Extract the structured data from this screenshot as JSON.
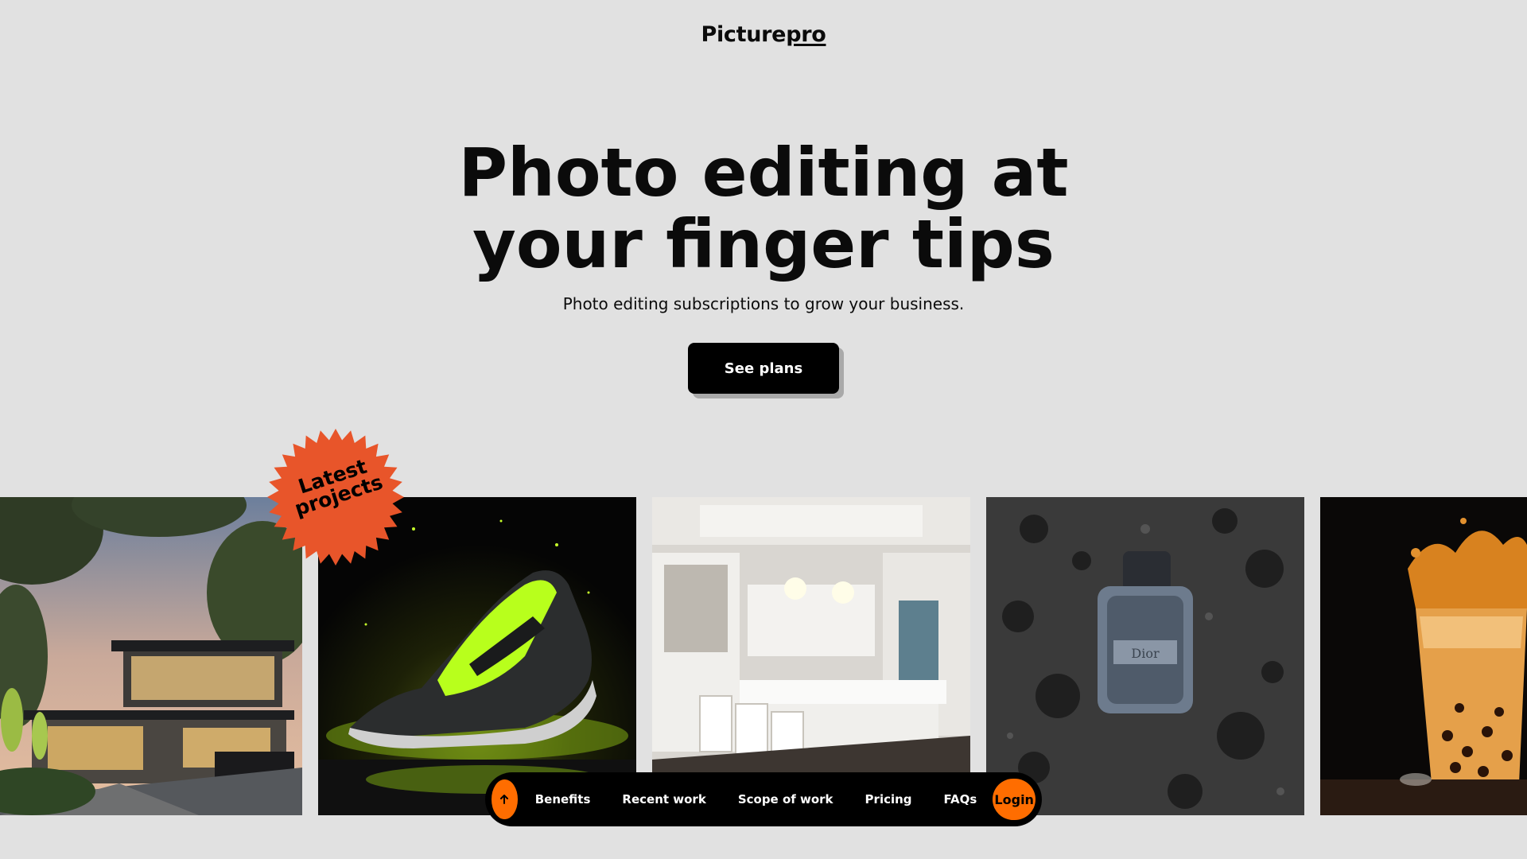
{
  "header": {
    "logo_main": "Picture",
    "logo_accent": "pro"
  },
  "hero": {
    "title_line1": "Photo editing at",
    "title_line2": "your finger tips",
    "subtitle": "Photo editing subscriptions to grow your business.",
    "cta_label": "See plans"
  },
  "badge": {
    "line1": "Latest",
    "line2": "projects",
    "color": "#e8552a"
  },
  "gallery": {
    "items": [
      {
        "subject": "modern house at dusk"
      },
      {
        "subject": "neon green running shoe"
      },
      {
        "subject": "white luxury kitchen"
      },
      {
        "subject": "Dior perfume bottle on dark rocks",
        "label": "Dior"
      },
      {
        "subject": "bubble tea splash"
      }
    ]
  },
  "nav": {
    "up_icon": "arrow-up-icon",
    "items": [
      "Benefits",
      "Recent work",
      "Scope of work",
      "Pricing",
      "FAQs"
    ],
    "login_label": "Login",
    "accent": "#ff6d00"
  }
}
